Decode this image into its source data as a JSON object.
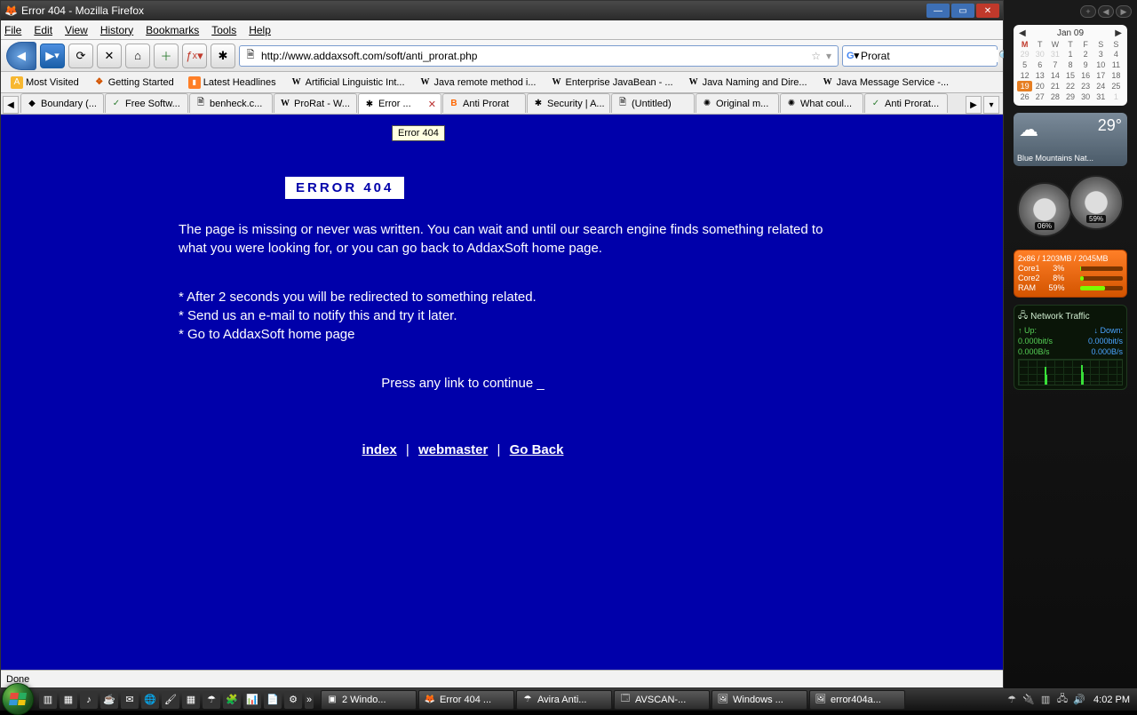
{
  "window": {
    "title": "Error 404 - Mozilla Firefox"
  },
  "menubar": [
    "File",
    "Edit",
    "View",
    "History",
    "Bookmarks",
    "Tools",
    "Help"
  ],
  "nav": {
    "url": "http://www.addaxsoft.com/soft/anti_prorat.php",
    "search_value": "Prorat",
    "search_engine": "G"
  },
  "bookmarks": [
    {
      "icon": "A",
      "cls": "favA",
      "label": "Most Visited"
    },
    {
      "icon": "❖",
      "cls": "favF",
      "label": "Getting Started"
    },
    {
      "icon": "▮",
      "cls": "favR",
      "label": "Latest Headlines"
    },
    {
      "icon": "W",
      "cls": "favW",
      "label": "Artificial Linguistic Int..."
    },
    {
      "icon": "W",
      "cls": "favW",
      "label": "Java remote method i..."
    },
    {
      "icon": "W",
      "cls": "favW",
      "label": "Enterprise JavaBean - ..."
    },
    {
      "icon": "W",
      "cls": "favW",
      "label": "Java Naming and Dire..."
    },
    {
      "icon": "W",
      "cls": "favW",
      "label": "Java Message Service -..."
    }
  ],
  "tabs": [
    {
      "icon": "◆",
      "cls": "",
      "label": "Boundary (..."
    },
    {
      "icon": "✓",
      "cls": "favG",
      "label": "Free Softw..."
    },
    {
      "icon": "🗎",
      "cls": "",
      "label": "benheck.c..."
    },
    {
      "icon": "W",
      "cls": "favW",
      "label": "ProRat - W..."
    },
    {
      "icon": "✱",
      "cls": "",
      "label": "Error ...",
      "active": true,
      "close": true
    },
    {
      "icon": "B",
      "cls": "favB",
      "label": "Anti Prorat"
    },
    {
      "icon": "✱",
      "cls": "",
      "label": "Security | A..."
    },
    {
      "icon": "🗎",
      "cls": "",
      "label": "(Untitled)"
    },
    {
      "icon": "✺",
      "cls": "",
      "label": "Original m..."
    },
    {
      "icon": "✺",
      "cls": "",
      "label": "What coul..."
    },
    {
      "icon": "✓",
      "cls": "favG",
      "label": "Anti Prorat..."
    }
  ],
  "tooltip": "Error 404",
  "page": {
    "heading": "ERROR 404",
    "para": "The page is missing or never was written. You can wait and until our search engine finds something related to what you were looking for, or you can go back to AddaxSoft home page.",
    "b1": "* After 2 seconds you will be redirected to something related.",
    "b2": "* Send us an e-mail to notify this and try it later.",
    "b3": "* Go to AddaxSoft home page",
    "continue": "Press any link to continue _",
    "link1": "index",
    "link2": "webmaster",
    "link3": "Go Back",
    "sep": "|"
  },
  "status": "Done",
  "sidebar": {
    "cal": {
      "month": "Jan 09",
      "dow": [
        "M",
        "T",
        "W",
        "T",
        "F",
        "S",
        "S"
      ],
      "rows": [
        [
          "29",
          "30",
          "31",
          "1",
          "2",
          "3",
          "4"
        ],
        [
          "5",
          "6",
          "7",
          "8",
          "9",
          "10",
          "11"
        ],
        [
          "12",
          "13",
          "14",
          "15",
          "16",
          "17",
          "18"
        ],
        [
          "19",
          "20",
          "21",
          "22",
          "23",
          "24",
          "25"
        ],
        [
          "26",
          "27",
          "28",
          "29",
          "30",
          "31",
          "1"
        ]
      ],
      "today": "19"
    },
    "weather": {
      "temp": "29°",
      "loc": "Blue Mountains Nat..."
    },
    "gauges": {
      "g1": "06%",
      "g2": "59%"
    },
    "cpu": {
      "head": "2x86 / 1203MB / 2045MB",
      "rows": [
        {
          "name": "Core1",
          "val": "3%",
          "pct": 3
        },
        {
          "name": "Core2",
          "val": "8%",
          "pct": 8
        },
        {
          "name": "RAM",
          "val": "59%",
          "pct": 59
        }
      ]
    },
    "net": {
      "title": "Network Traffic",
      "upL": "Up:",
      "downL": "Down:",
      "up1": "0.000bit/s",
      "down1": "0.000bit/s",
      "up2": "0.000B/s",
      "down2": "0.000B/s"
    }
  },
  "taskbar": {
    "tasks": [
      {
        "icon": "▣",
        "label": "2 Windo..."
      },
      {
        "icon": "🦊",
        "label": "Error 404 ..."
      },
      {
        "icon": "☂",
        "label": "Avira Anti..."
      },
      {
        "icon": "🗔",
        "label": "AVSCAN-..."
      },
      {
        "icon": "🖼",
        "label": "Windows ..."
      },
      {
        "icon": "🖼",
        "label": "error404a..."
      }
    ],
    "clock": "4:02 PM"
  }
}
